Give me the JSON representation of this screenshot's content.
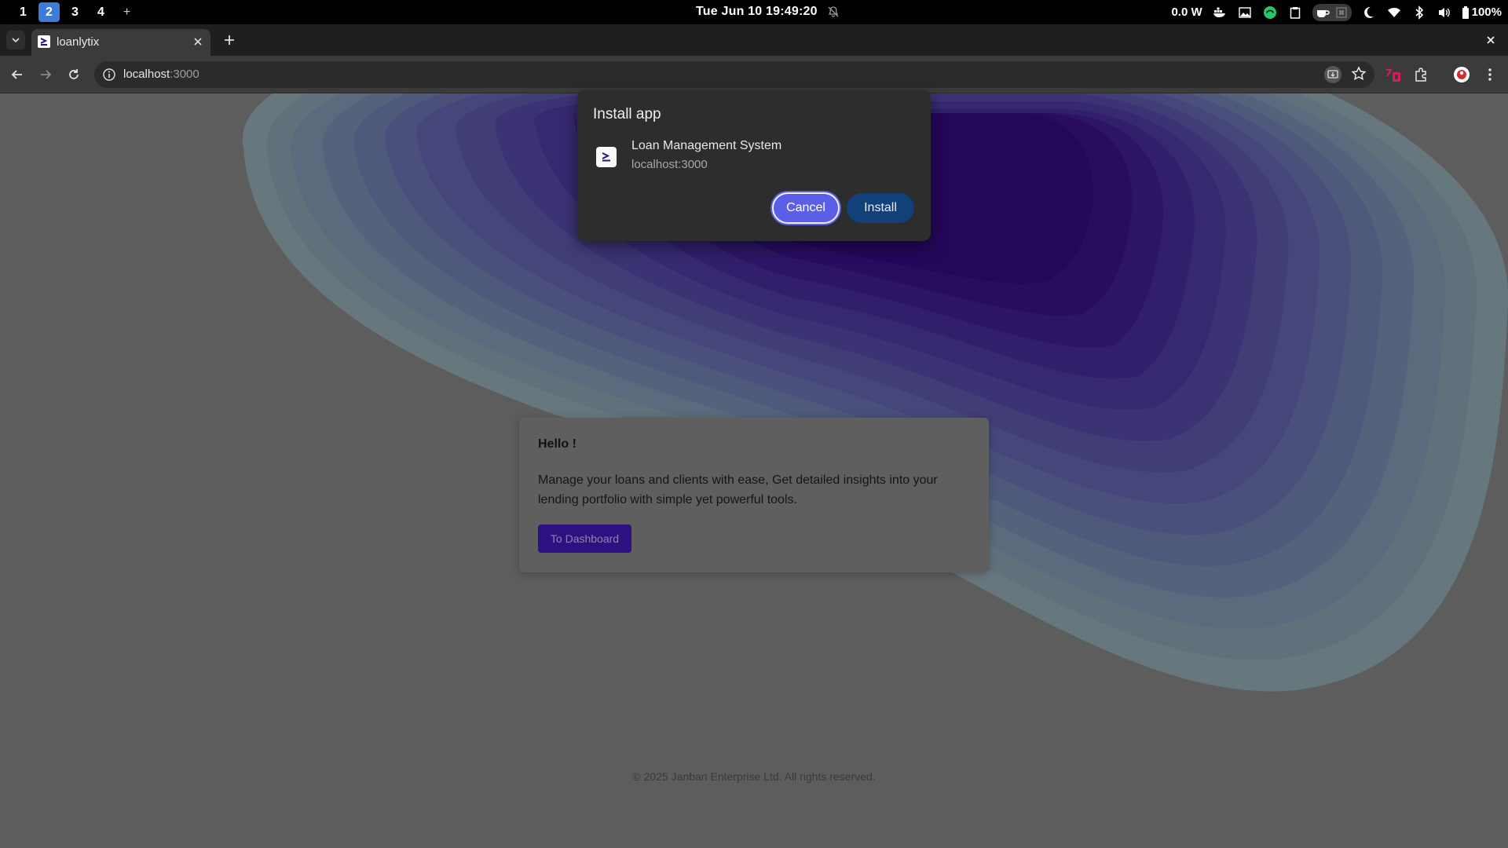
{
  "system_bar": {
    "workspaces": [
      "1",
      "2",
      "3",
      "4"
    ],
    "active_workspace": "2",
    "add_workspace": "+",
    "clock": "Tue Jun 10  19:49:20",
    "power": "0.0 W",
    "battery": "100%"
  },
  "browser": {
    "tab": {
      "title": "loanlytix"
    },
    "address": {
      "host": "localhost",
      "port": ":3000"
    }
  },
  "dialog": {
    "title": "Install app",
    "app_name": "Loan Management System",
    "app_url": "localhost:3000",
    "cancel_label": "Cancel",
    "install_label": "Install"
  },
  "card": {
    "title": "Hello !",
    "body": "Manage your loans and clients with ease, Get detailed insights into your lending portfolio with simple yet powerful tools.",
    "button_label": "To Dashboard"
  },
  "footer": {
    "text": "© 2025 Janban Enterprise Ltd. All rights reserved."
  },
  "colors": {
    "accent": "#5b5fe8",
    "install": "#12407a",
    "brand": "#2e1180"
  }
}
